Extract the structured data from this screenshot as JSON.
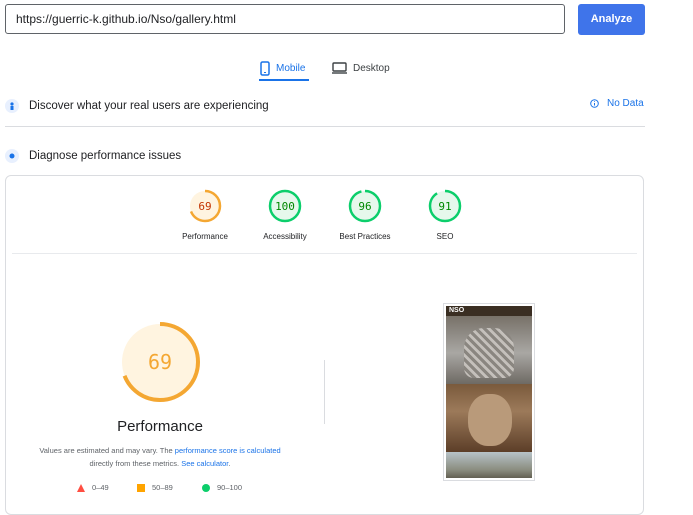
{
  "url_bar": {
    "value": "https://guerric-k.github.io/Nso/gallery.html",
    "analyze_label": "Analyze"
  },
  "tabs": [
    {
      "label": "Mobile",
      "icon": "mobile-phone-icon",
      "active": true
    },
    {
      "label": "Desktop",
      "icon": "desktop-monitor-icon",
      "active": false
    }
  ],
  "sections": {
    "discover": {
      "label": "Discover what your real users are experiencing",
      "icon": "users-icon",
      "status": "No Data"
    },
    "diagnose": {
      "label": "Diagnose performance issues",
      "icon": "lab-flask-icon"
    }
  },
  "scores": [
    {
      "label": "Performance",
      "value": 69,
      "color": "#f4a732",
      "bg": "#fff4e0"
    },
    {
      "label": "Accessibility",
      "value": 100,
      "color": "#0cce6b",
      "bg": "#e6f8ec"
    },
    {
      "label": "Best Practices",
      "value": 96,
      "color": "#0cce6b",
      "bg": "#e6f8ec"
    },
    {
      "label": "SEO",
      "value": 91,
      "color": "#0cce6b",
      "bg": "#e6f8ec"
    }
  ],
  "main_score": {
    "value": 69,
    "label": "Performance",
    "color": "#f4a732",
    "bg": "#fff4e0"
  },
  "disclaimer": {
    "prefix": "Values are estimated and may vary. The ",
    "link1": "performance score is calculated",
    "middle": "directly from these metrics. ",
    "link2": "See calculator",
    "suffix": "."
  },
  "legend": [
    {
      "range": "0–49",
      "shape": "triangle",
      "color": "#ff4e42"
    },
    {
      "range": "50–89",
      "shape": "square",
      "color": "#ffa400"
    },
    {
      "range": "90–100",
      "shape": "circle",
      "color": "#0cce6b"
    }
  ],
  "screenshot": {
    "caption": "NSO"
  }
}
